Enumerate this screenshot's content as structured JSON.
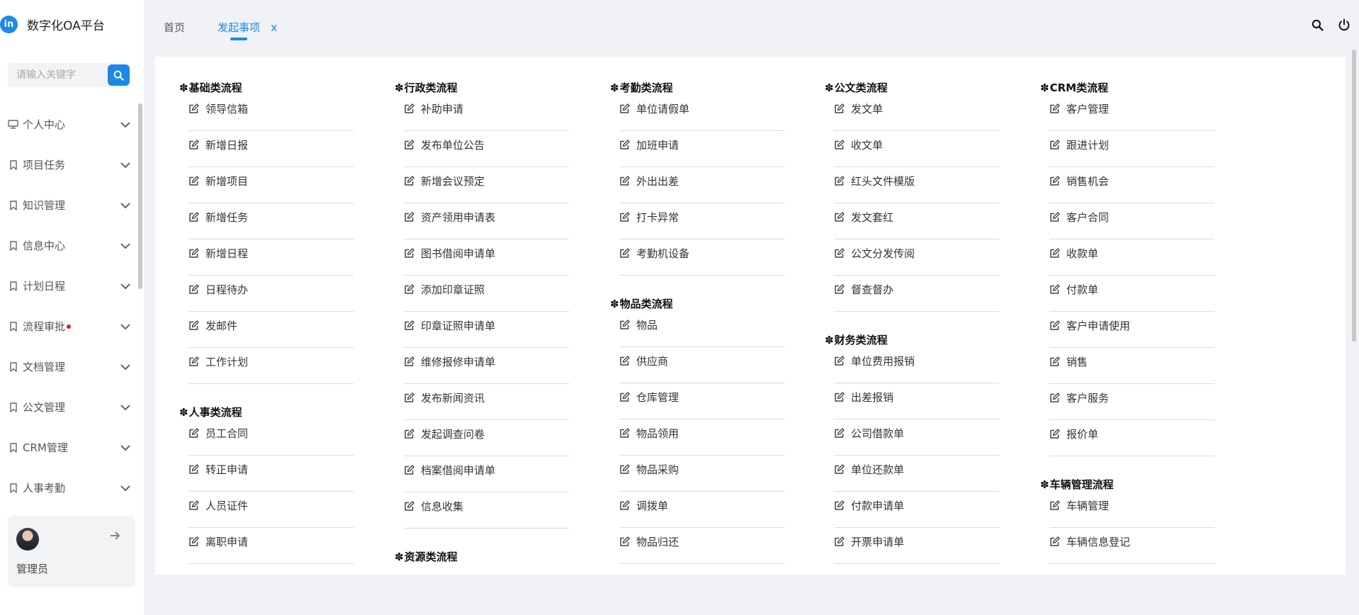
{
  "app": {
    "logo_badge": "in",
    "title": "数字化OA平台"
  },
  "search": {
    "placeholder": "请输入关键字"
  },
  "sidebar": {
    "items": [
      {
        "label": "个人中心",
        "icon": "monitor-icon"
      },
      {
        "label": "项目任务",
        "icon": "bookmark-icon"
      },
      {
        "label": "知识管理",
        "icon": "bookmark-icon"
      },
      {
        "label": "信息中心",
        "icon": "bookmark-icon"
      },
      {
        "label": "计划日程",
        "icon": "bookmark-icon"
      },
      {
        "label": "流程审批",
        "icon": "bookmark-icon",
        "badge": true
      },
      {
        "label": "文档管理",
        "icon": "bookmark-icon"
      },
      {
        "label": "公文管理",
        "icon": "bookmark-icon"
      },
      {
        "label": "CRM管理",
        "icon": "bookmark-icon"
      },
      {
        "label": "人事考勤",
        "icon": "bookmark-icon"
      }
    ]
  },
  "user": {
    "name": "管理员"
  },
  "tabs": [
    {
      "label": "首页"
    },
    {
      "label": "发起事项",
      "close": "x"
    }
  ],
  "accent_color": "#1a8ae6",
  "columns": [
    {
      "groups": [
        {
          "title": "基础类流程",
          "items": [
            "领导信箱",
            "新增日报",
            "新增项目",
            "新增任务",
            "新增日程",
            "日程待办",
            "发邮件",
            "工作计划"
          ]
        },
        {
          "title": "人事类流程",
          "items": [
            "员工合同",
            "转正申请",
            "人员证件",
            "离职申请"
          ]
        }
      ]
    },
    {
      "groups": [
        {
          "title": "行政类流程",
          "items": [
            "补助申请",
            "发布单位公告",
            "新增会议预定",
            "资产领用申请表",
            "图书借阅申请单",
            "添加印章证照",
            "印章证照申请单",
            "维修报修申请单",
            "发布新闻资讯",
            "发起调查问卷",
            "档案借阅申请单",
            "信息收集"
          ]
        },
        {
          "title": "资源类流程",
          "items": []
        }
      ]
    },
    {
      "groups": [
        {
          "title": "考勤类流程",
          "items": [
            "单位请假单",
            "加班申请",
            "外出出差",
            "打卡异常",
            "考勤机设备"
          ]
        },
        {
          "title": "物品类流程",
          "items": [
            "物品",
            "供应商",
            "仓库管理",
            "物品领用",
            "物品采购",
            "调拨单",
            "物品归还"
          ]
        }
      ]
    },
    {
      "groups": [
        {
          "title": "公文类流程",
          "items": [
            "发文单",
            "收文单",
            "红头文件模版",
            "发文套红",
            "公文分发传阅",
            "督查督办"
          ]
        },
        {
          "title": "财务类流程",
          "items": [
            "单位费用报销",
            "出差报销",
            "公司借款单",
            "单位还款单",
            "付款申请单",
            "开票申请单"
          ]
        }
      ]
    },
    {
      "groups": [
        {
          "title": "CRM类流程",
          "items": [
            "客户管理",
            "跟进计划",
            "销售机会",
            "客户合同",
            "收款单",
            "付款单",
            "客户申请使用",
            "销售",
            "客户服务",
            "报价单"
          ]
        },
        {
          "title": "车辆管理流程",
          "items": [
            "车辆管理",
            "车辆信息登记"
          ]
        }
      ]
    }
  ]
}
